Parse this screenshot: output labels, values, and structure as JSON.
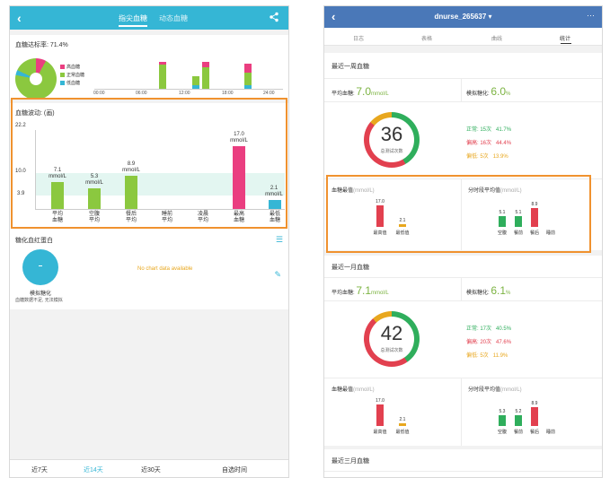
{
  "left": {
    "tabs": [
      "指尖血糖",
      "动态血糖"
    ],
    "compliance": {
      "label": "血糖达标率: 71.4%"
    },
    "pie_legend": [
      {
        "label": "高血糖",
        "color": "#ea3e80"
      },
      {
        "label": "正常血糖",
        "color": "#8bc83f"
      },
      {
        "label": "低血糖",
        "color": "#35b6d5"
      }
    ],
    "time_axis": [
      "00:00",
      "06:00",
      "12:00",
      "18:00",
      "24:00"
    ],
    "fluctuation": {
      "title": "血糖波动: (画)",
      "y_ticks": [
        "22.2",
        "10.0",
        "3.9"
      ],
      "values": [
        "7.1\nmmol/L",
        "5.3\nmmol/L",
        "8.9\nmmol/L",
        "17.0\nmmol/L",
        "2.1\nmmol/L"
      ],
      "categories": [
        "平均\n血糖",
        "空腹\n平均",
        "餐后\n平均",
        "睡前\n平均",
        "凌晨\n平均",
        "最高\n血糖",
        "最低\n血糖"
      ]
    },
    "hba1c": {
      "title": "糖化血红蛋白",
      "no_data": "No chart data available",
      "est_label": "模拟糖化",
      "note": "血糖数据不足, 无法模拟"
    },
    "bottom_tabs": [
      "近7天",
      "近14天",
      "近30天",
      "自选时间"
    ]
  },
  "right": {
    "title": "dnurse_265637 ▾",
    "subtabs": [
      "日志",
      "表格",
      "曲线",
      "统计"
    ],
    "week": {
      "title": "最近一周血糖",
      "avg_label": "平均血糖:",
      "avg_value": "7.0",
      "avg_unit": "mmol/L",
      "a1c_label": "模拟糖化:",
      "a1c_value": "6.0",
      "a1c_unit": "%",
      "count": "36",
      "count_label": "总测试次数",
      "stats": [
        {
          "label": "正常:",
          "count": "15次",
          "pct": "41.7%",
          "color": "#2fae5c"
        },
        {
          "label": "偏高:",
          "count": "16次",
          "pct": "44.4%",
          "color": "#e2404f"
        },
        {
          "label": "偏低:",
          "count": "5次",
          "pct": "13.9%",
          "color": "#e8a71e"
        }
      ],
      "extreme_title": "血糖最值",
      "extreme_unit": "(mmol/L)",
      "extreme": [
        {
          "label": "最高值",
          "value": "17.0"
        },
        {
          "label": "最低值",
          "value": "2.1"
        }
      ],
      "period_title": "分时段平均值",
      "period_unit": "(mmol/L)",
      "period": [
        {
          "label": "空腹",
          "value": "5.1"
        },
        {
          "label": "餐前",
          "value": "5.1"
        },
        {
          "label": "餐后",
          "value": "8.9"
        },
        {
          "label": "睡前",
          "value": ""
        }
      ]
    },
    "month": {
      "title": "最近一月血糖",
      "avg_label": "平均血糖:",
      "avg_value": "7.1",
      "avg_unit": "mmol/L",
      "a1c_label": "模拟糖化:",
      "a1c_value": "6.1",
      "a1c_unit": "%",
      "count": "42",
      "count_label": "总测试次数",
      "stats": [
        {
          "label": "正常:",
          "count": "17次",
          "pct": "40.5%",
          "color": "#2fae5c"
        },
        {
          "label": "偏高:",
          "count": "20次",
          "pct": "47.6%",
          "color": "#e2404f"
        },
        {
          "label": "偏低:",
          "count": "5次",
          "pct": "11.9%",
          "color": "#e8a71e"
        }
      ],
      "extreme_title": "血糖最值",
      "extreme_unit": "(mmol/L)",
      "extreme": [
        {
          "label": "最高值",
          "value": "17.0"
        },
        {
          "label": "最低值",
          "value": "2.1"
        }
      ],
      "period_title": "分时段平均值",
      "period_unit": "(mmol/L)",
      "period": [
        {
          "label": "空腹",
          "value": "5.3"
        },
        {
          "label": "餐前",
          "value": "5.2"
        },
        {
          "label": "餐后",
          "value": "8.9"
        },
        {
          "label": "睡前",
          "value": ""
        }
      ]
    },
    "three_month": {
      "title": "最近三月血糖"
    }
  }
}
